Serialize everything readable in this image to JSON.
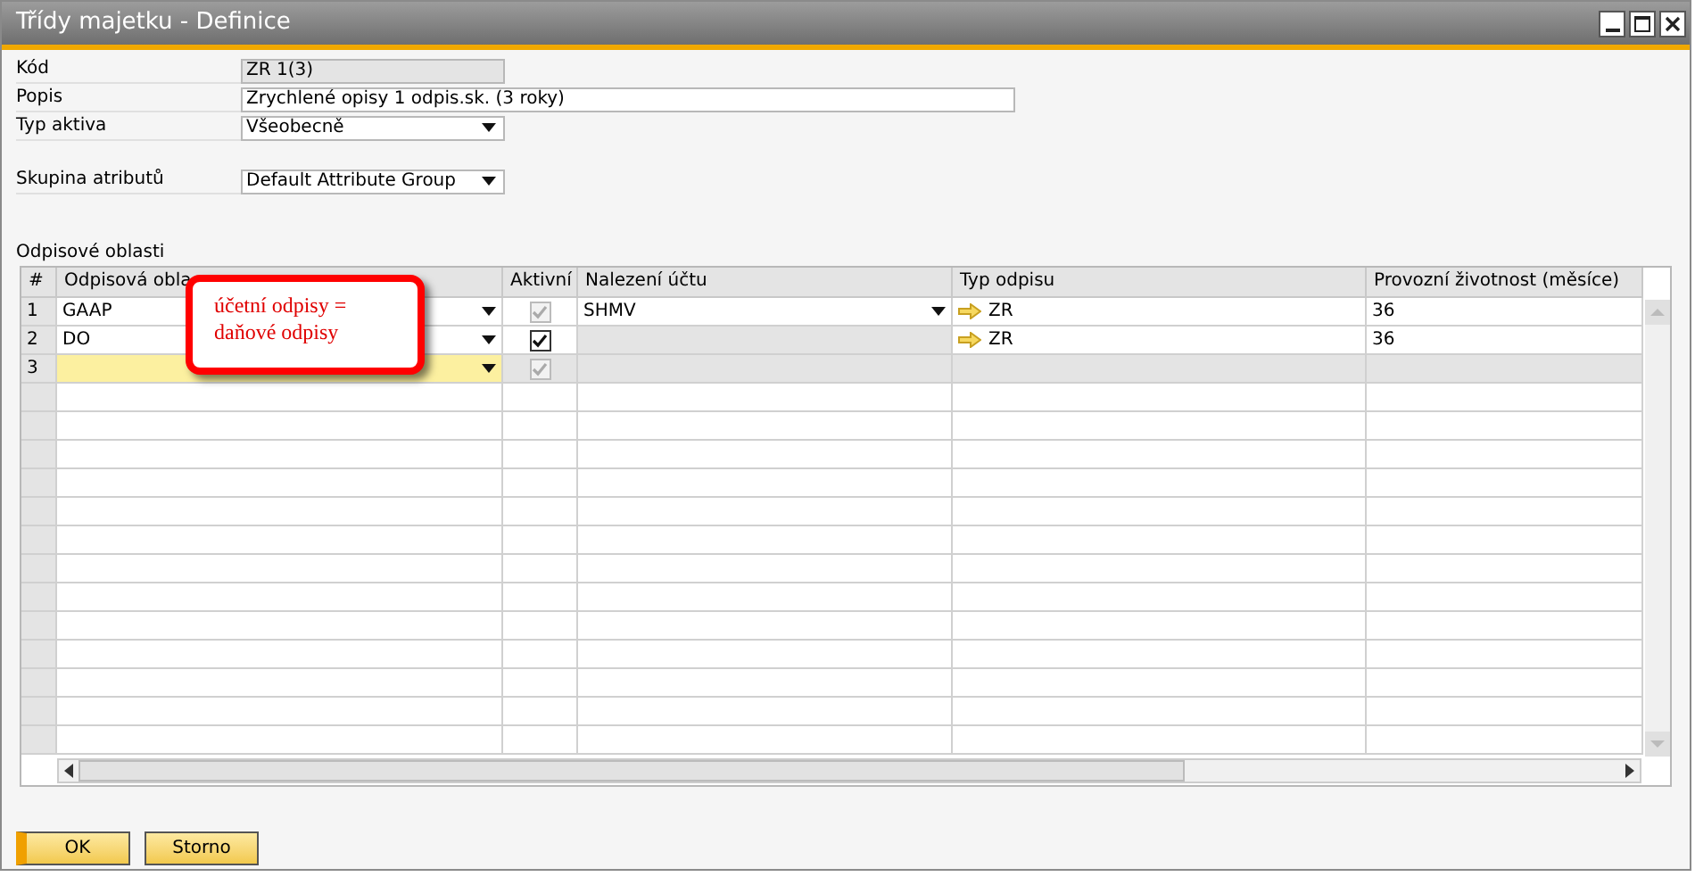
{
  "window": {
    "title": "Třídy majetku - Definice"
  },
  "fields": [
    {
      "label": "Kód",
      "value": "ZR 1(3)",
      "kind": "readonly"
    },
    {
      "label": "Popis",
      "value": "Zrychlené opisy 1 odpis.sk. (3 roky)",
      "kind": "text"
    },
    {
      "label": "Typ aktiva",
      "value": "Všeobecně",
      "kind": "dropdown"
    },
    {
      "label": "Skupina atributů",
      "value": "Default Attribute Group",
      "kind": "dropdown"
    }
  ],
  "table": {
    "title": "Odpisové oblasti",
    "columns": [
      "#",
      "Odpisová obla",
      "Aktivní",
      "Nalezení účtu",
      "Typ odpisu",
      "Provozní životnost (měsíce)"
    ],
    "rows": [
      {
        "number": "1",
        "area": "GAAP",
        "active": {
          "checked": true,
          "disabled": true
        },
        "account": "SHMV",
        "account_editable": true,
        "type": "ZR",
        "life": "36",
        "selected": false
      },
      {
        "number": "2",
        "area": "DO",
        "active": {
          "checked": true,
          "disabled": false
        },
        "account_editable": false,
        "type": "ZR",
        "life": "36",
        "selected": false
      },
      {
        "number": "3",
        "active": {
          "checked": true,
          "disabled": true
        },
        "account_editable": false,
        "selected": true
      }
    ]
  },
  "callout": {
    "text": "účetní odpisy =\ndaňové odpisy"
  },
  "buttons": [
    {
      "label": "OK",
      "default": true
    },
    {
      "label": "Storno",
      "default": false
    }
  ]
}
